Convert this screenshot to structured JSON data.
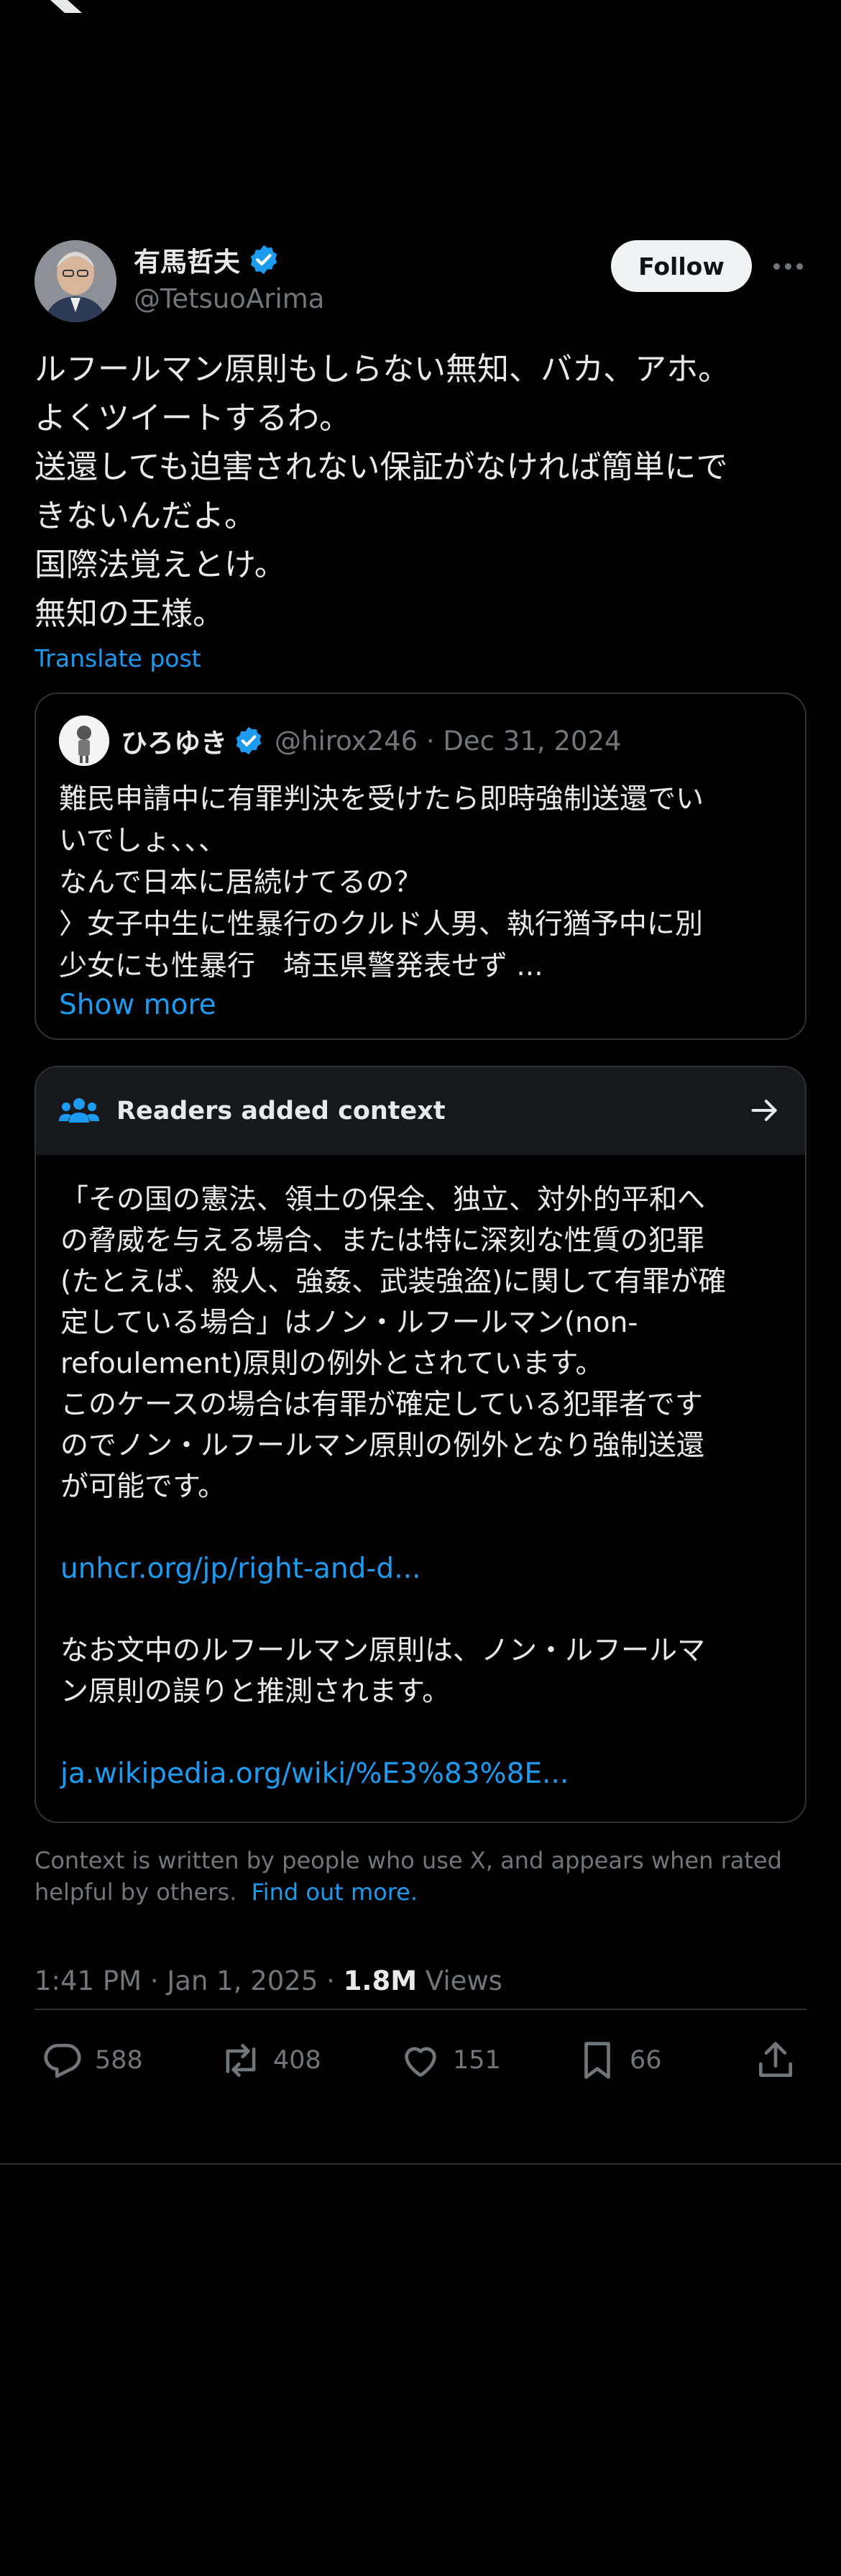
{
  "app": {
    "logo_icon": "x-logo-icon"
  },
  "post": {
    "author_name": "有馬哲夫",
    "author_handle": "@TetsuoArima",
    "follow_label": "Follow",
    "body_lines": [
      "ルフールマン原則もしらない無知、バカ、アホ。",
      "よくツイートするわ。",
      "送還しても迫害されない保証がなければ簡単にで",
      "きないんだよ。",
      "国際法覚えとけ。",
      "無知の王様。"
    ],
    "translate_label": "Translate post"
  },
  "quote": {
    "author_name": "ひろゆき",
    "author_handle": "@hirox246 · Dec 31, 2024",
    "text_lines": [
      "難民申請中に有罪判決を受けたら即時強制送還でい",
      "いでしょ、、、",
      "なんで日本に居続けてるの？",
      "〉女子中生に性暴行のクルド人男、執行猶予中に別",
      "少女にも性暴行　埼玉県警発表せず ..."
    ],
    "show_more_label": "Show more"
  },
  "context": {
    "title": "Readers added context",
    "para1": [
      "「その国の憲法、領土の保全、独立、対外的平和へ",
      "の脅威を与える場合、または特に深刻な性質の犯罪",
      "(たとえば、殺人、強姦、武装強盗)に関して有罪が確",
      "定している場合」はノン・ルフールマン(non-",
      "refoulement)原則の例外とされています。",
      "このケースの場合は有罪が確定している犯罪者です",
      "のでノン・ルフールマン原則の例外となり強制送還",
      "が可能です。"
    ],
    "link1": "unhcr.org/jp/right-and-d...",
    "para2": [
      "なお文中のルフールマン原則は、ノン・ルフールマ",
      "ン原則の誤りと推測されます。"
    ],
    "link2": "ja.wikipedia.org/wiki/%E3%83%8E..."
  },
  "disclaimer": {
    "line1": "Context is written by people who use X, and appears when rated",
    "line2": "helpful by others.",
    "find_out_more": "Find out more."
  },
  "meta": {
    "timestamp": "1:41 PM · Jan 1, 2025 · ",
    "views_count": "1.8M",
    "views_label": " Views"
  },
  "actions": {
    "replies": "588",
    "reposts": "408",
    "likes": "151",
    "bookmarks": "66"
  },
  "colors": {
    "background": "#000000",
    "text": "#e7e9ea",
    "secondary": "#71767b",
    "accent": "#1d9bf0",
    "border": "#2f3336"
  }
}
